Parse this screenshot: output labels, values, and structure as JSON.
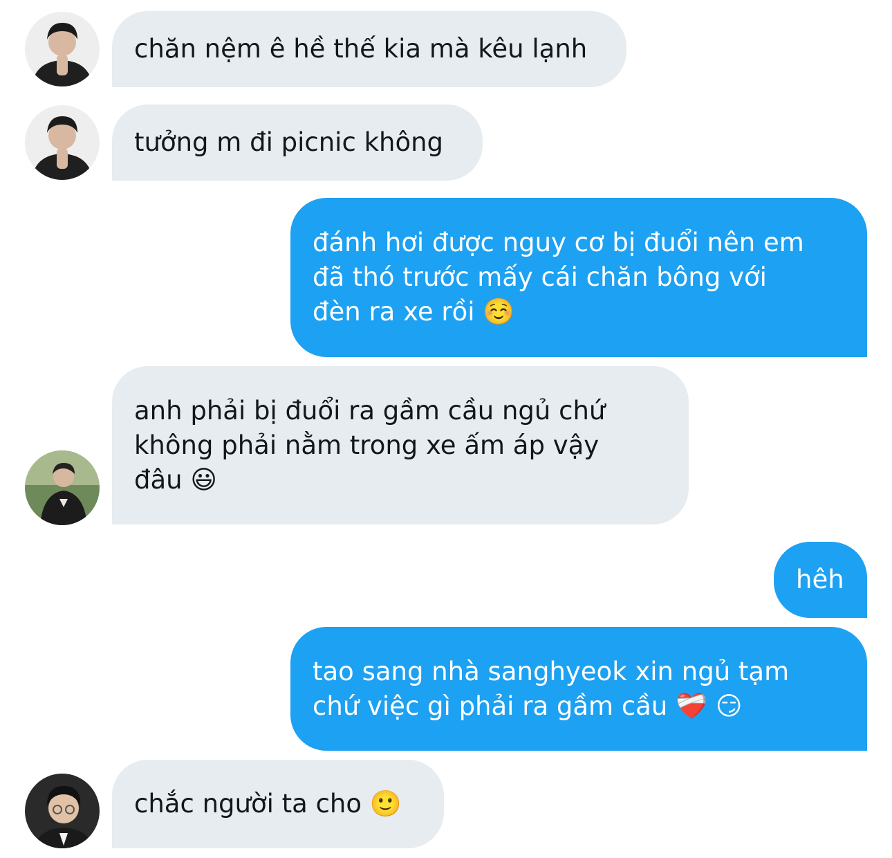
{
  "conversation": {
    "messages": [
      {
        "direction": "incoming",
        "avatar": "avatar-icon",
        "text": "chăn nệm ê hề thế kia mà kêu lạnh"
      },
      {
        "direction": "incoming",
        "avatar": "avatar-icon",
        "text": "tưởng m đi picnic không"
      },
      {
        "direction": "outgoing",
        "text": "đánh hơi được nguy cơ bị đuổi nên em\nđã thó trước mấy cái chăn bông với\nđèn ra xe rồi ☺️"
      },
      {
        "direction": "incoming",
        "avatar": "avatar-icon",
        "text": "anh phải bị đuổi ra gầm cầu ngủ chứ\nkhông phải nằm trong xe ấm áp vậy\nđâu 😃"
      },
      {
        "direction": "outgoing",
        "text": "hêh"
      },
      {
        "direction": "outgoing",
        "text": "tao sang nhà sanghyeok xin ngủ tạm\nchứ việc gì phải ra gầm cầu ❤️‍🩹 😏"
      },
      {
        "direction": "incoming",
        "avatar": "avatar-icon",
        "text": "chắc người ta cho 🙂"
      }
    ]
  },
  "colors": {
    "incoming_bubble": "#e6ecf0",
    "incoming_text": "#14171a",
    "outgoing_bubble": "#1da1f2",
    "outgoing_text": "#ffffff"
  }
}
